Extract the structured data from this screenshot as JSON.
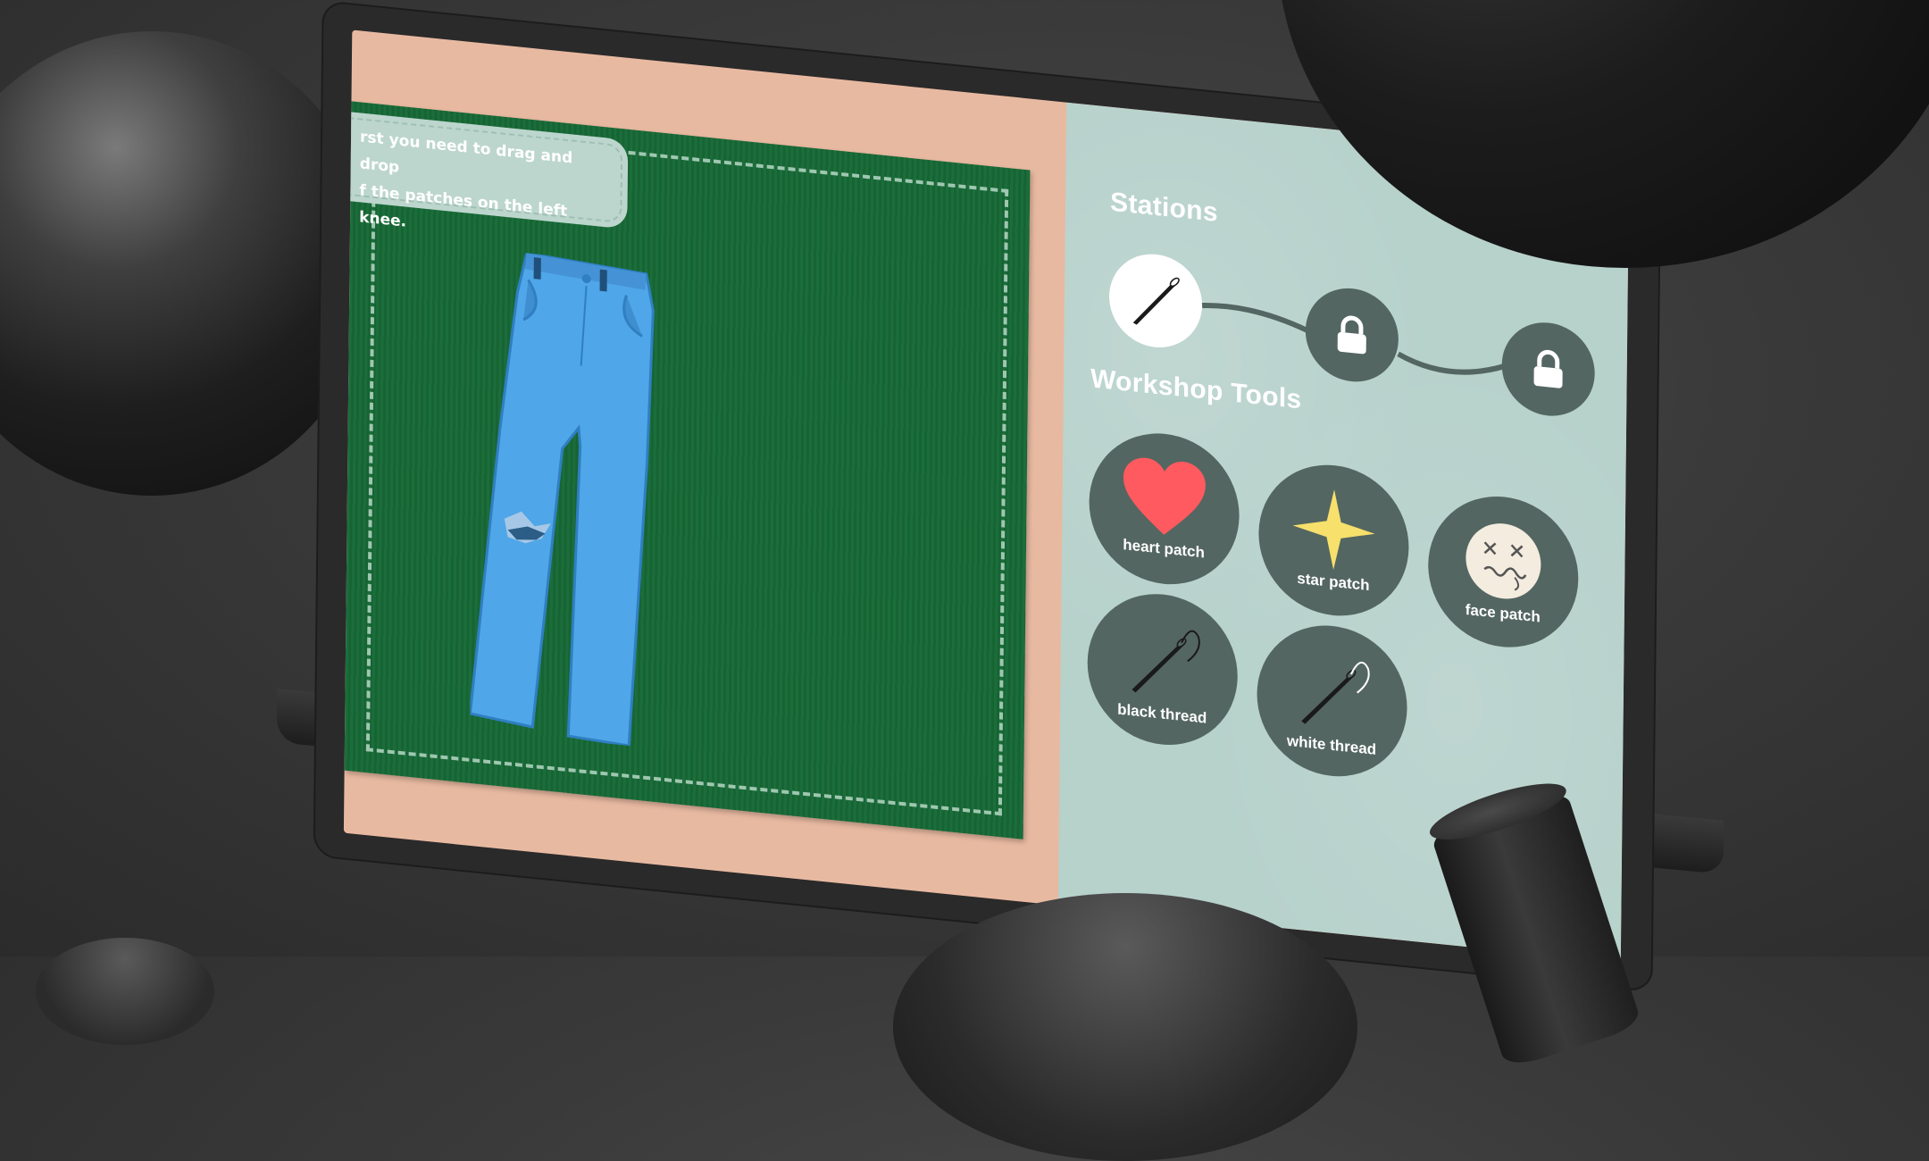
{
  "instructions": {
    "line1": "rst you need to drag and drop",
    "line2": "f the patches on the left knee."
  },
  "stations": {
    "title": "Stations",
    "items": [
      {
        "id": "station-1",
        "icon": "needle-icon",
        "state": "active"
      },
      {
        "id": "station-2",
        "icon": "lock-icon",
        "state": "locked"
      },
      {
        "id": "station-3",
        "icon": "lock-icon",
        "state": "locked"
      }
    ]
  },
  "workshop_tools": {
    "title": "Workshop Tools",
    "items": [
      {
        "label": "heart patch",
        "icon": "heart-icon"
      },
      {
        "label": "star patch",
        "icon": "star-icon"
      },
      {
        "label": "face patch",
        "icon": "face-icon"
      },
      {
        "label": "black thread",
        "icon": "needle-black-thread-icon"
      },
      {
        "label": "white thread",
        "icon": "needle-white-thread-icon"
      }
    ]
  },
  "colors": {
    "work_area_green": "#1b6e3c",
    "panel_bg": "#b7d1cb",
    "tool_circle": "#546661",
    "jeans_blue": "#4fa6e8",
    "heart_red": "#ff5a5f",
    "star_yellow": "#f7e06b",
    "background_peach": "#e8b9a1"
  }
}
